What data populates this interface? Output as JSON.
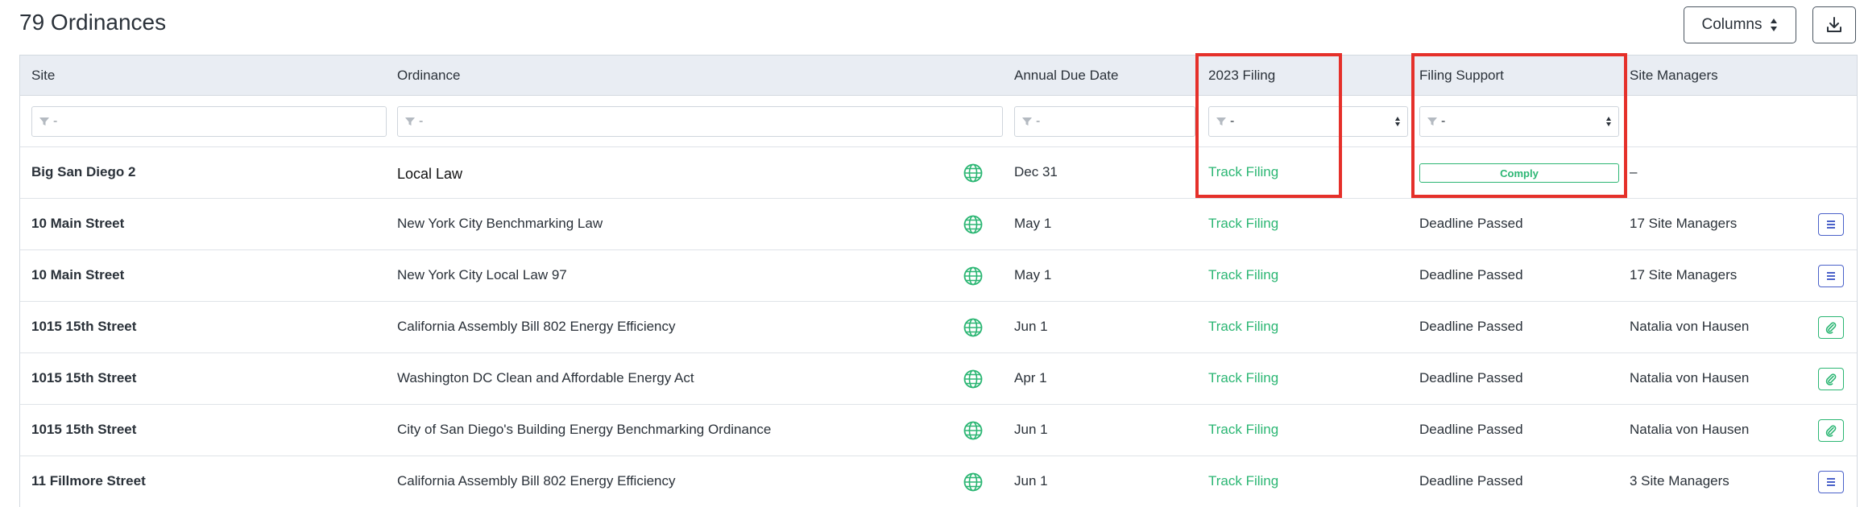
{
  "header": {
    "title": "79 Ordinances",
    "columns_button": "Columns"
  },
  "table": {
    "columns": [
      "Site",
      "Ordinance",
      "Annual Due Date",
      "2023 Filing",
      "Filing Support",
      "Site Managers"
    ],
    "filter_placeholder": "-",
    "rows": [
      {
        "site": "Big San Diego 2",
        "ordinance": "Local Law",
        "due": "Dec 31",
        "filing": "Track Filing",
        "support": "Comply",
        "managers": "–",
        "action": ""
      },
      {
        "site": "10 Main Street",
        "ordinance": "New York City Benchmarking Law",
        "due": "May 1",
        "filing": "Track Filing",
        "support": "Deadline Passed",
        "managers": "17 Site Managers",
        "action": "list-icon"
      },
      {
        "site": "10 Main Street",
        "ordinance": "New York City Local Law 97",
        "due": "May 1",
        "filing": "Track Filing",
        "support": "Deadline Passed",
        "managers": "17 Site Managers",
        "action": "list-icon"
      },
      {
        "site": "1015 15th Street",
        "ordinance": "California Assembly Bill 802 Energy Efficiency",
        "due": "Jun 1",
        "filing": "Track Filing",
        "support": "Deadline Passed",
        "managers": "Natalia von Hausen",
        "action": "paperclip-icon"
      },
      {
        "site": "1015 15th Street",
        "ordinance": "Washington DC Clean and Affordable Energy Act",
        "due": "Apr 1",
        "filing": "Track Filing",
        "support": "Deadline Passed",
        "managers": "Natalia von Hausen",
        "action": "paperclip-icon"
      },
      {
        "site": "1015 15th Street",
        "ordinance": "City of San Diego's Building Energy Benchmarking Ordinance",
        "due": "Jun 1",
        "filing": "Track Filing",
        "support": "Deadline Passed",
        "managers": "Natalia von Hausen",
        "action": "paperclip-icon"
      },
      {
        "site": "11 Fillmore Street",
        "ordinance": "California Assembly Bill 802 Energy Efficiency",
        "due": "Jun 1",
        "filing": "Track Filing",
        "support": "Deadline Passed",
        "managers": "3 Site Managers",
        "action": "list-icon"
      }
    ]
  },
  "colors": {
    "accent_green": "#2bb673",
    "highlight_red": "#e5302a",
    "action_blue": "#4a61c9",
    "header_bg": "#e9edf3"
  }
}
